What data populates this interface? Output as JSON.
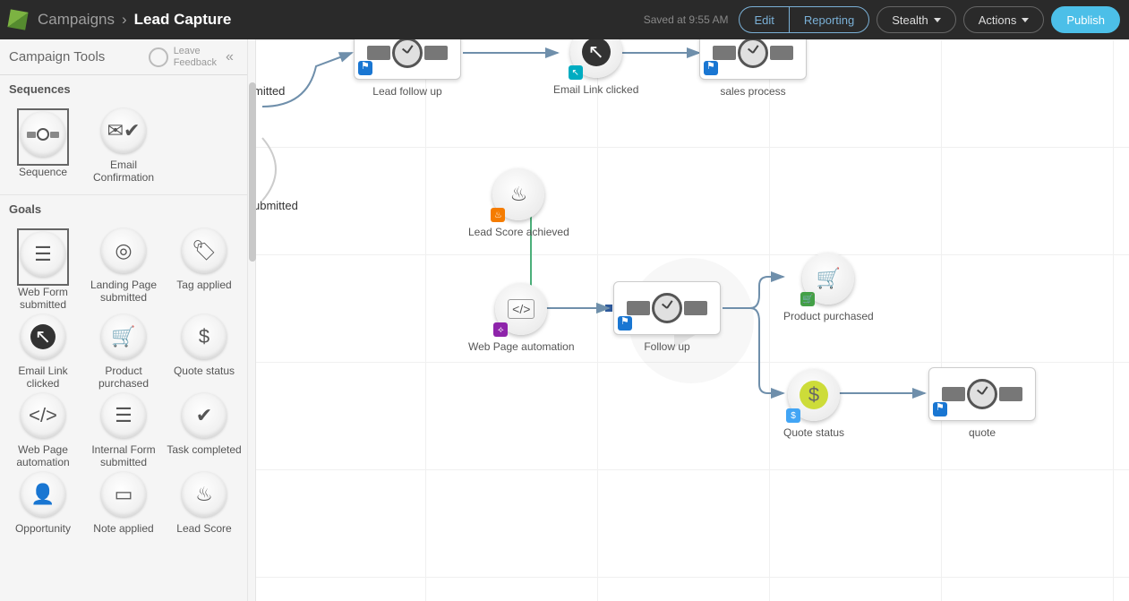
{
  "header": {
    "breadcrumb_root": "Campaigns",
    "breadcrumb_sep": "›",
    "page_title": "Lead Capture",
    "saved_text": "Saved at 9:55 AM",
    "edit": "Edit",
    "reporting": "Reporting",
    "stealth": "Stealth",
    "actions": "Actions",
    "publish": "Publish"
  },
  "sidebar": {
    "title": "Campaign Tools",
    "feedback_line1": "Leave",
    "feedback_line2": "Feedback",
    "sections": {
      "sequences": "Sequences",
      "goals": "Goals"
    },
    "seq_items": [
      {
        "label": "Sequence"
      },
      {
        "label": "Email Confirmation"
      }
    ],
    "goal_items": [
      {
        "label": "Web Form submitted"
      },
      {
        "label": "Landing Page submitted"
      },
      {
        "label": "Tag applied"
      },
      {
        "label": "Email Link clicked"
      },
      {
        "label": "Product purchased"
      },
      {
        "label": "Quote status"
      },
      {
        "label": "Web Page automation"
      },
      {
        "label": "Internal Form submitted"
      },
      {
        "label": "Task completed"
      },
      {
        "label": "Opportunity"
      },
      {
        "label": "Note applied"
      },
      {
        "label": "Lead Score"
      }
    ]
  },
  "canvas": {
    "cut_nodes": {
      "submitted1": "mitted",
      "submitted2": "ubmitted"
    },
    "nodes": {
      "lead_follow_up": "Lead follow up",
      "email_link_clicked": "Email Link clicked",
      "sales_process": "sales process",
      "lead_score_achieved": "Lead Score achieved",
      "web_page_automation": "Web Page automation",
      "follow_up": "Follow up",
      "product_purchased": "Product purchased",
      "quote_status": "Quote status",
      "quote": "quote"
    }
  }
}
